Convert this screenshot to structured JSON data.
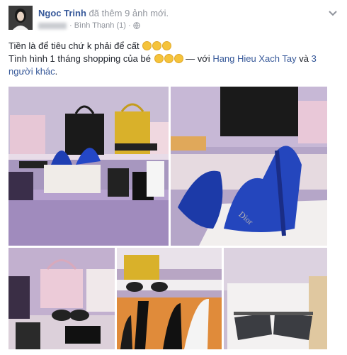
{
  "post": {
    "author": "Ngoc Trinh",
    "action": " đã thêm 9 ảnh mới.",
    "location": "· Bình Thạnh (1) ·",
    "text_line1": "Tiền là để tiêu chứ k phải để cất",
    "text_line2": "Tình hình 1 tháng shopping của bé",
    "tag_prefix": " — với ",
    "tagged_name": "Hang Hieu Xach Tay",
    "tag_and": " và ",
    "others": "3 người khác",
    "tag_end": "."
  },
  "photos": {
    "brand_label": "Dior"
  },
  "icons": {
    "menu": "chevron-down-icon",
    "privacy": "globe-icon",
    "emoji": "emoji-icon"
  },
  "colors": {
    "author": "#365899",
    "meta": "#90949c",
    "text": "#1d2129"
  }
}
